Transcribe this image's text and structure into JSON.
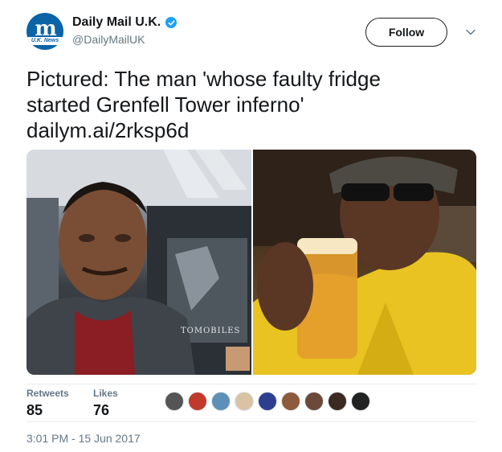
{
  "account": {
    "display_name": "Daily Mail U.K.",
    "handle": "@DailyMailUK",
    "logo_text": "m",
    "logo_sub": "U.K. News",
    "verified_icon": "verified-badge-icon"
  },
  "follow_label": "Follow",
  "tweet": {
    "line1": "Pictured: The man 'whose faulty fridge",
    "line2": "started Grenfell Tower inferno'",
    "link": "dailym.ai/2rksp6d"
  },
  "media": {
    "left_sign_text": "TOMOBILES"
  },
  "stats": {
    "retweets_label": "Retweets",
    "retweets_value": "85",
    "likes_label": "Likes",
    "likes_value": "76"
  },
  "timestamp": "3:01 PM - 15 Jun 2017",
  "colors": {
    "brand_blue": "#0b63a8",
    "verified_blue": "#1da1f2"
  }
}
